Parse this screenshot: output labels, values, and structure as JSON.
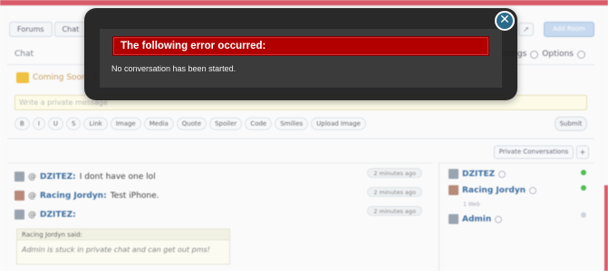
{
  "breadcrumbs": [
    "Forums",
    "Chat",
    ""
  ],
  "header": {
    "add_button": "Add Room"
  },
  "chat": {
    "title": "Chat",
    "settings_label": "Settings",
    "options_label": "Options",
    "news": "Coming Soon: Superjam Series II, Starts Feb 2013!",
    "input_placeholder": "Write a private message",
    "toolbar": [
      "B",
      "I",
      "U",
      "S",
      "Link",
      "Image",
      "Media",
      "Quote",
      "Spoiler",
      "Code",
      "Smilies",
      "Upload Image"
    ],
    "submit_label": "Submit",
    "private_tab": "Private Conversations",
    "private_plus": "+",
    "messages": [
      {
        "user": "DZITEZ:",
        "text": "I dont have one lol",
        "time": "2 minutes ago"
      },
      {
        "user": "Racing Jordyn:",
        "text": "Test iPhone.",
        "time": "2 minutes ago"
      },
      {
        "user": "DZITEZ:",
        "text": "",
        "time": "2 minutes ago"
      }
    ],
    "quote": {
      "header": "Racing Jordyn said:",
      "body": "Admin is stuck in private chat and can get out pms!"
    }
  },
  "users": [
    {
      "name": "DZITEZ",
      "status": "online"
    },
    {
      "name": "Racing Jordyn",
      "status": "online",
      "sub": "1 Web"
    },
    {
      "name": "Admin",
      "status": "offline"
    }
  ],
  "modal": {
    "title": "The following error occurred:",
    "message": "No conversation has been started.",
    "close_glyph": "✕"
  },
  "colors": {
    "error_bar": "#b20000",
    "close_button": "#2a6a8a",
    "link": "#3f6fa0",
    "online": "#4fbf4f"
  }
}
